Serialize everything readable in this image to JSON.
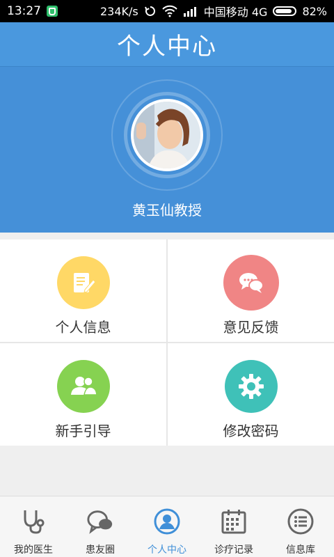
{
  "status_bar": {
    "time": "13:27",
    "net_speed": "234K/s",
    "carrier": "中国移动 4G",
    "battery": "82%"
  },
  "header": {
    "title": "个人中心"
  },
  "profile": {
    "name": "黄玉仙教授"
  },
  "grid_items": [
    {
      "label": "个人信息",
      "icon": "edit-note-icon",
      "color": "#ffd866"
    },
    {
      "label": "意见反馈",
      "icon": "chat-bubbles-icon",
      "color": "#f08585"
    },
    {
      "label": "新手引导",
      "icon": "users-icon",
      "color": "#86d251"
    },
    {
      "label": "修改密码",
      "icon": "gear-icon",
      "color": "#3fc1b8"
    }
  ],
  "tabs": [
    {
      "label": "我的医生",
      "icon": "stethoscope-icon"
    },
    {
      "label": "患友圈",
      "icon": "chat-icon"
    },
    {
      "label": "个人中心",
      "icon": "person-icon",
      "active": true
    },
    {
      "label": "诊疗记录",
      "icon": "calendar-icon"
    },
    {
      "label": "信息库",
      "icon": "list-icon"
    }
  ],
  "colors": {
    "primary": "#4590d8",
    "active_tab": "#3f8fd8"
  }
}
